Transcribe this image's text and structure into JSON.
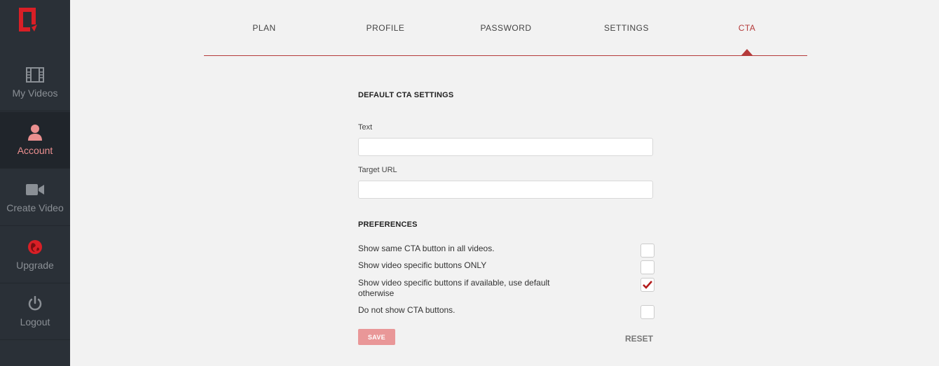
{
  "colors": {
    "accent": "#b53b3b",
    "sidebar_bg": "#2a3037",
    "active_item": "#ea8f8f",
    "save_bg": "#e99798"
  },
  "sidebar": {
    "items": [
      {
        "label": "My Videos",
        "icon": "film-icon",
        "active": false
      },
      {
        "label": "Account",
        "icon": "user-icon",
        "active": true
      },
      {
        "label": "Create Video",
        "icon": "video-camera-icon",
        "active": false
      },
      {
        "label": "Upgrade",
        "icon": "globe-icon",
        "active": false
      },
      {
        "label": "Logout",
        "icon": "power-icon",
        "active": false
      }
    ]
  },
  "tabs": [
    {
      "label": "PLAN"
    },
    {
      "label": "PROFILE"
    },
    {
      "label": "PASSWORD"
    },
    {
      "label": "SETTINGS"
    },
    {
      "label": "CTA",
      "active": true
    }
  ],
  "cta": {
    "title": "DEFAULT CTA SETTINGS",
    "text_label": "Text",
    "text_value": "",
    "url_label": "Target URL",
    "url_value": ""
  },
  "preferences": {
    "title": "PREFERENCES",
    "options": [
      {
        "label": "Show same CTA button in all videos.",
        "checked": false
      },
      {
        "label": "Show video specific buttons ONLY",
        "checked": false
      },
      {
        "label": "Show video specific buttons if available, use default otherwise",
        "checked": true
      },
      {
        "label": "Do not show CTA buttons.",
        "checked": false
      }
    ]
  },
  "actions": {
    "save_label": "SAVE",
    "reset_label": "RESET"
  }
}
